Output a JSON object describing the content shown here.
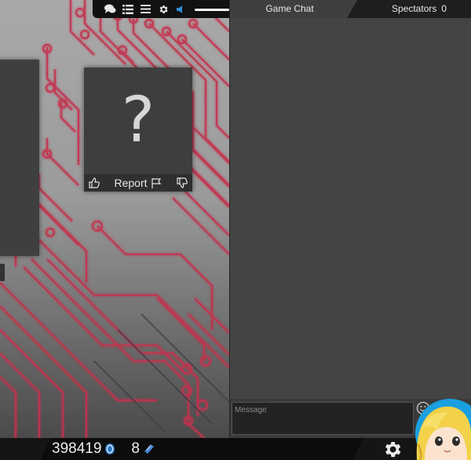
{
  "toolbar": {
    "icons": [
      "chat-icon",
      "list-icon",
      "menu-icon",
      "gear-icon",
      "volume-icon"
    ],
    "volume_level": 1.0
  },
  "card": {
    "symbol": "?",
    "report_label": "Report"
  },
  "chat": {
    "tab_game_chat": "Game Chat",
    "tab_spectators": "Spectators",
    "spectators_count": "0",
    "message_placeholder": "Message"
  },
  "status": {
    "coins": "398419",
    "tickets": "8"
  },
  "colors": {
    "circuit_trace": "#c4304e",
    "panel_bg": "#444445",
    "chat_header_bg": "#1e1e1e",
    "volume_accent": "#2a8fd6"
  }
}
